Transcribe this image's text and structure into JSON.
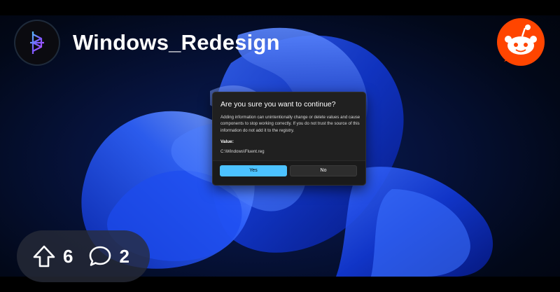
{
  "header": {
    "subreddit": "Windows_Redesign"
  },
  "dialog": {
    "title": "Are you sure you want to continue?",
    "body": "Adding information can unintentionally change or delete values and cause components to stop working correctly. If you do not trust the source of this information do not add it to the registry.",
    "value_label": "Value:",
    "value": "C:\\Windows\\Fluent.reg",
    "yes_label": "Yes",
    "no_label": "No"
  },
  "stats": {
    "upvotes": "6",
    "comments": "2"
  },
  "colors": {
    "reddit_orange": "#ff4500",
    "accent_blue": "#4cc2ff"
  }
}
